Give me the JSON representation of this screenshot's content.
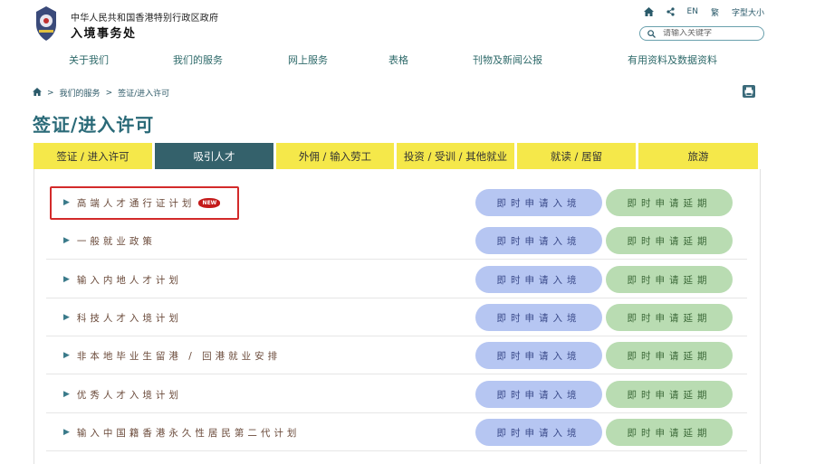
{
  "header": {
    "gov_name": "中华人民共和国香港特别行政区政府",
    "dept_name": "入境事务处",
    "tools": {
      "home_icon": "home-icon",
      "share_icon": "share-icon",
      "lang_en": "EN",
      "lang_trad": "繁",
      "font_size": "字型大小"
    },
    "search": {
      "placeholder": "请输入关键字",
      "value": ""
    }
  },
  "nav": {
    "items": [
      {
        "label": "关于我们"
      },
      {
        "label": "我们的服务"
      },
      {
        "label": "网上服务"
      },
      {
        "label": "表格"
      },
      {
        "label": "刊物及新闻公报"
      },
      {
        "label": "有用资料及数据资料"
      }
    ]
  },
  "breadcrumb": {
    "items": [
      {
        "label": "我们的服务"
      },
      {
        "label": "签证/进入许可"
      }
    ]
  },
  "page_title": "签证/进入许可",
  "tabs": [
    {
      "label": "签证 / 进入许可",
      "active": false
    },
    {
      "label": "吸引人才",
      "active": true
    },
    {
      "label": "外佣 / 输入劳工",
      "active": false
    },
    {
      "label": "投资 / 受训 / 其他就业",
      "active": false
    },
    {
      "label": "就读 / 居留",
      "active": false
    },
    {
      "label": "旅游",
      "active": false
    }
  ],
  "schemes": [
    {
      "label": "高端人才通行证计划",
      "is_new": true,
      "new_badge": "NEW",
      "entry_button": "即时申请入境",
      "extend_button": "即时申请延期"
    },
    {
      "label": "一般就业政策",
      "is_new": false,
      "entry_button": "即时申请入境",
      "extend_button": "即时申请延期"
    },
    {
      "label": "输入内地人才计划",
      "is_new": false,
      "entry_button": "即时申请入境",
      "extend_button": "即时申请延期"
    },
    {
      "label": "科技人才入境计划",
      "is_new": false,
      "entry_button": "即时申请入境",
      "extend_button": "即时申请延期"
    },
    {
      "label": "非本地毕业生留港 / 回港就业安排",
      "is_new": false,
      "entry_button": "即时申请入境",
      "extend_button": "即时申请延期"
    },
    {
      "label": "优秀人才入境计划",
      "is_new": false,
      "entry_button": "即时申请入境",
      "extend_button": "即时申请延期"
    },
    {
      "label": "输入中国籍香港永久性居民第二代计划",
      "is_new": false,
      "entry_button": "即时申请入境",
      "extend_button": "即时申请延期"
    }
  ],
  "colors": {
    "accent": "#2a6a78",
    "tab_yellow": "#f5e84a",
    "tab_active": "#34616b",
    "entry_button": "#b6c6f2",
    "extend_button": "#b9dcb2",
    "highlight": "#d32a2a"
  }
}
